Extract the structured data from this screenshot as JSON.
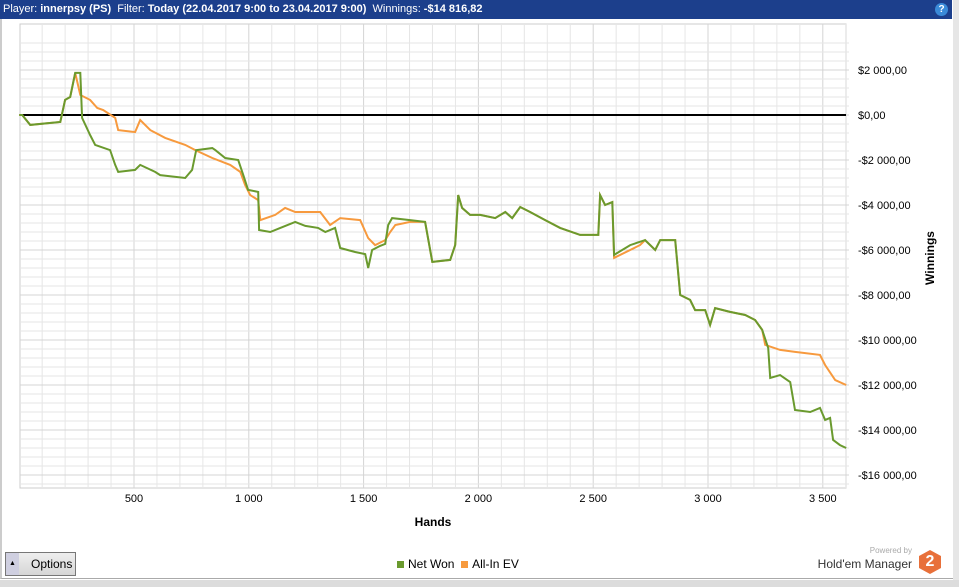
{
  "header": {
    "player_label": "Player:",
    "player": "innerpsy (PS)",
    "filter_label": "Filter:",
    "filter": "Today (22.04.2017 9:00 to 23.04.2017 9:00)",
    "winnings_label": "Winnings:",
    "winnings": "-$14 816,82",
    "help": "?"
  },
  "options_label": "Options",
  "branding": {
    "powered": "Powered by",
    "name": "Hold'em Manager",
    "badge": "2"
  },
  "chart_data": {
    "type": "line",
    "xlabel": "Hands",
    "ylabel": "Winnings",
    "xlim": [
      0,
      3600
    ],
    "ylim": [
      -16500,
      3500
    ],
    "xticks": [
      500,
      1000,
      1500,
      2000,
      2500,
      3000,
      3500
    ],
    "xtick_labels": [
      "500",
      "1 000",
      "1 500",
      "2 000",
      "2 500",
      "3 000",
      "3 500"
    ],
    "yticks": [
      2000,
      0,
      -2000,
      -4000,
      -6000,
      -8000,
      -10000,
      -12000,
      -14000,
      -16000
    ],
    "ytick_labels": [
      "$2 000,00",
      "$0,00",
      "-$2 000,00",
      "-$4 000,00",
      "-$6 000,00",
      "-$8 000,00",
      "-$10 000,00",
      "-$12 000,00",
      "-$14 000,00",
      "-$16 000,00"
    ],
    "grid": true,
    "legend_position": "bottom",
    "series": [
      {
        "name": "Net Won",
        "color": "#6a9a2e",
        "points": [
          [
            0,
            0
          ],
          [
            13,
            0
          ],
          [
            48,
            -440
          ],
          [
            179,
            -310
          ],
          [
            200,
            670
          ],
          [
            222,
            800
          ],
          [
            244,
            1870
          ],
          [
            266,
            1870
          ],
          [
            274,
            -130
          ],
          [
            309,
            -890
          ],
          [
            331,
            -1330
          ],
          [
            396,
            -1560
          ],
          [
            418,
            -2220
          ],
          [
            431,
            -2530
          ],
          [
            505,
            -2440
          ],
          [
            527,
            -2220
          ],
          [
            592,
            -2530
          ],
          [
            614,
            -2670
          ],
          [
            723,
            -2800
          ],
          [
            753,
            -2440
          ],
          [
            771,
            -1560
          ],
          [
            841,
            -1470
          ],
          [
            854,
            -1560
          ],
          [
            897,
            -1910
          ],
          [
            954,
            -2000
          ],
          [
            976,
            -2670
          ],
          [
            997,
            -3330
          ],
          [
            1041,
            -3420
          ],
          [
            1045,
            -5110
          ],
          [
            1093,
            -5200
          ],
          [
            1137,
            -5020
          ],
          [
            1202,
            -4750
          ],
          [
            1246,
            -4930
          ],
          [
            1302,
            -5020
          ],
          [
            1333,
            -5200
          ],
          [
            1376,
            -5020
          ],
          [
            1398,
            -5910
          ],
          [
            1463,
            -6090
          ],
          [
            1507,
            -6180
          ],
          [
            1520,
            -6800
          ],
          [
            1537,
            -6000
          ],
          [
            1572,
            -5820
          ],
          [
            1594,
            -5730
          ],
          [
            1607,
            -4890
          ],
          [
            1624,
            -4580
          ],
          [
            1703,
            -4670
          ],
          [
            1768,
            -4750
          ],
          [
            1799,
            -6530
          ],
          [
            1877,
            -6440
          ],
          [
            1899,
            -5780
          ],
          [
            1912,
            -3560
          ],
          [
            1929,
            -4130
          ],
          [
            1964,
            -4440
          ],
          [
            2008,
            -4440
          ],
          [
            2073,
            -4580
          ],
          [
            2117,
            -4310
          ],
          [
            2147,
            -4580
          ],
          [
            2182,
            -4090
          ],
          [
            2225,
            -4310
          ],
          [
            2291,
            -4670
          ],
          [
            2356,
            -5020
          ],
          [
            2443,
            -5330
          ],
          [
            2522,
            -5330
          ],
          [
            2530,
            -3560
          ],
          [
            2552,
            -4000
          ],
          [
            2583,
            -3870
          ],
          [
            2591,
            -6220
          ],
          [
            2661,
            -5780
          ],
          [
            2726,
            -5560
          ],
          [
            2770,
            -6000
          ],
          [
            2792,
            -5560
          ],
          [
            2857,
            -5560
          ],
          [
            2879,
            -8000
          ],
          [
            2922,
            -8220
          ],
          [
            2944,
            -8670
          ],
          [
            2988,
            -8670
          ],
          [
            3009,
            -9330
          ],
          [
            3031,
            -8580
          ],
          [
            3096,
            -8750
          ],
          [
            3162,
            -8890
          ],
          [
            3205,
            -9110
          ],
          [
            3236,
            -9550
          ],
          [
            3262,
            -10350
          ],
          [
            3271,
            -11690
          ],
          [
            3314,
            -11560
          ],
          [
            3358,
            -11870
          ],
          [
            3379,
            -13110
          ],
          [
            3445,
            -13200
          ],
          [
            3488,
            -13020
          ],
          [
            3510,
            -13550
          ],
          [
            3532,
            -13460
          ],
          [
            3545,
            -14440
          ],
          [
            3575,
            -14670
          ],
          [
            3602,
            -14800
          ]
        ]
      },
      {
        "name": "All-In EV",
        "color": "#f79a3e",
        "points": [
          [
            0,
            0
          ],
          [
            13,
            0
          ],
          [
            48,
            -440
          ],
          [
            179,
            -310
          ],
          [
            200,
            670
          ],
          [
            222,
            800
          ],
          [
            244,
            1870
          ],
          [
            266,
            890
          ],
          [
            309,
            670
          ],
          [
            340,
            310
          ],
          [
            366,
            220
          ],
          [
            418,
            -130
          ],
          [
            431,
            -670
          ],
          [
            505,
            -760
          ],
          [
            527,
            -220
          ],
          [
            571,
            -670
          ],
          [
            636,
            -1020
          ],
          [
            723,
            -1330
          ],
          [
            767,
            -1560
          ],
          [
            841,
            -1910
          ],
          [
            919,
            -2220
          ],
          [
            963,
            -2530
          ],
          [
            984,
            -3110
          ],
          [
            1006,
            -3560
          ],
          [
            1041,
            -3780
          ],
          [
            1050,
            -4670
          ],
          [
            1115,
            -4440
          ],
          [
            1158,
            -4130
          ],
          [
            1202,
            -4310
          ],
          [
            1311,
            -4310
          ],
          [
            1354,
            -4890
          ],
          [
            1398,
            -4580
          ],
          [
            1485,
            -4670
          ],
          [
            1520,
            -5470
          ],
          [
            1550,
            -5780
          ],
          [
            1594,
            -5560
          ],
          [
            1616,
            -5200
          ],
          [
            1638,
            -4890
          ],
          [
            1703,
            -4750
          ],
          [
            1768,
            -4750
          ],
          [
            1799,
            -6530
          ],
          [
            1877,
            -6440
          ],
          [
            1899,
            -5780
          ],
          [
            1912,
            -3560
          ],
          [
            1929,
            -4130
          ],
          [
            1964,
            -4440
          ],
          [
            2008,
            -4440
          ],
          [
            2073,
            -4580
          ],
          [
            2117,
            -4310
          ],
          [
            2147,
            -4580
          ],
          [
            2182,
            -4090
          ],
          [
            2225,
            -4310
          ],
          [
            2291,
            -4670
          ],
          [
            2356,
            -5020
          ],
          [
            2443,
            -5330
          ],
          [
            2522,
            -5330
          ],
          [
            2530,
            -3560
          ],
          [
            2552,
            -4000
          ],
          [
            2583,
            -3870
          ],
          [
            2591,
            -6350
          ],
          [
            2704,
            -5780
          ],
          [
            2726,
            -5560
          ],
          [
            2770,
            -6000
          ],
          [
            2792,
            -5560
          ],
          [
            2857,
            -5560
          ],
          [
            2879,
            -8000
          ],
          [
            2922,
            -8220
          ],
          [
            2944,
            -8670
          ],
          [
            2988,
            -8670
          ],
          [
            3009,
            -9330
          ],
          [
            3031,
            -8580
          ],
          [
            3096,
            -8750
          ],
          [
            3162,
            -8890
          ],
          [
            3205,
            -9110
          ],
          [
            3236,
            -9550
          ],
          [
            3249,
            -10220
          ],
          [
            3314,
            -10440
          ],
          [
            3379,
            -10530
          ],
          [
            3488,
            -10660
          ],
          [
            3510,
            -11110
          ],
          [
            3554,
            -11780
          ],
          [
            3602,
            -12000
          ]
        ]
      }
    ]
  }
}
